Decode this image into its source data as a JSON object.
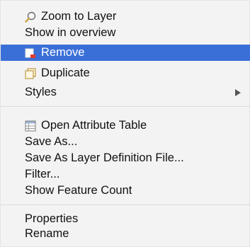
{
  "context_menu": {
    "items": [
      {
        "label": "Zoom to Layer",
        "icon": "zoom-to-layer-icon"
      },
      {
        "label": "Show in overview"
      },
      {
        "label": "Remove",
        "icon": "remove-layer-icon",
        "highlighted": true
      },
      {
        "label": "Duplicate",
        "icon": "duplicate-layer-icon"
      },
      {
        "label": "Styles",
        "has_submenu": true
      },
      {
        "label": "Open Attribute Table",
        "icon": "attribute-table-icon"
      },
      {
        "label": "Save As..."
      },
      {
        "label": "Save As Layer Definition File..."
      },
      {
        "label": "Filter..."
      },
      {
        "label": "Show Feature Count"
      },
      {
        "label": "Properties"
      },
      {
        "label": "Rename"
      }
    ]
  },
  "colors": {
    "menu_background": "#f3f3f3",
    "highlight": "#3a6fd8",
    "highlight_text": "#ffffff",
    "text": "#111111"
  }
}
